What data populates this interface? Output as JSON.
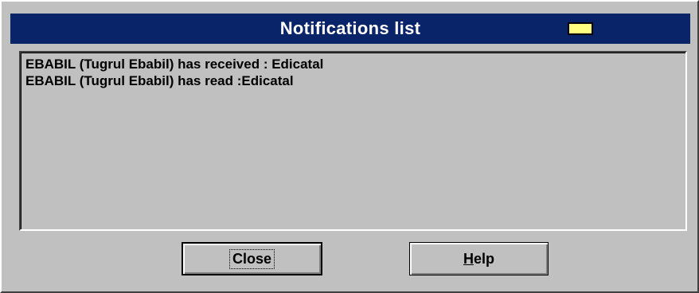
{
  "window": {
    "title": "Notifications list",
    "indicator_color": "#ffff80"
  },
  "notifications": {
    "items": [
      "EBABIL (Tugrul Ebabil) has received : Edicatal",
      "EBABIL (Tugrul Ebabil) has read :Edicatal"
    ]
  },
  "buttons": {
    "close_label": "Close",
    "help_key": "H",
    "help_rest": "elp"
  },
  "colors": {
    "titlebar": "#0a246a",
    "face": "#c0c0c0"
  }
}
